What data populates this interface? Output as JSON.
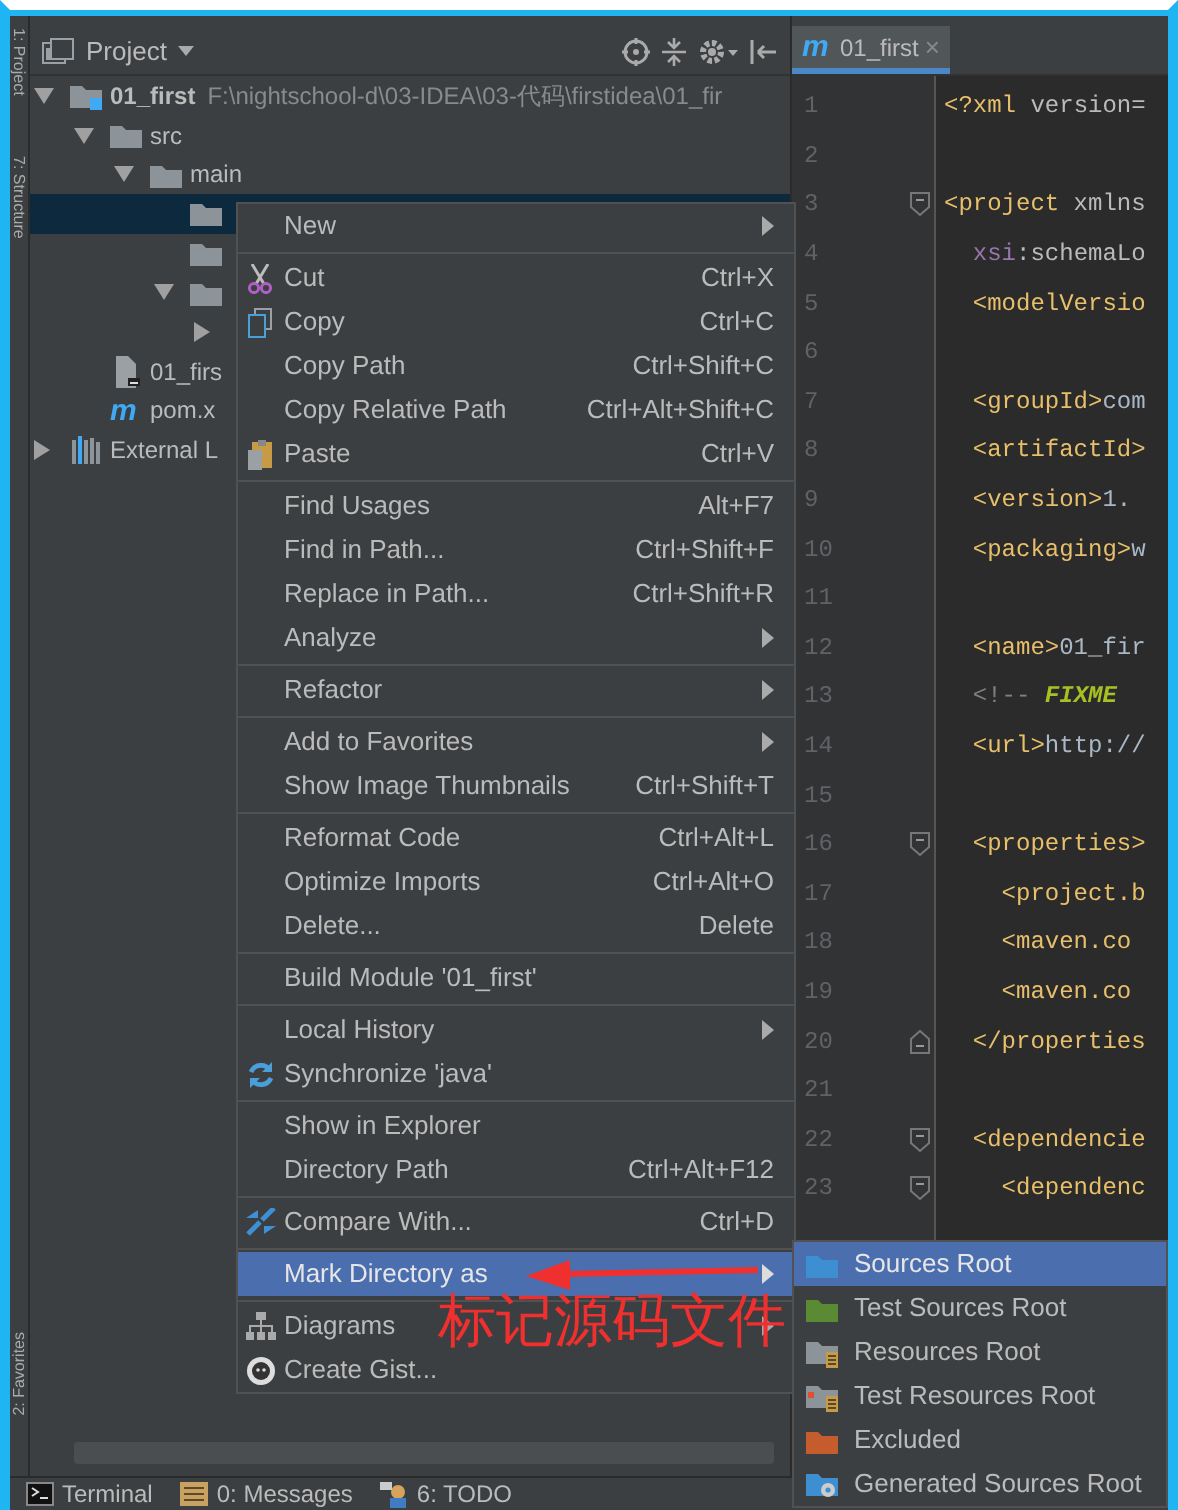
{
  "sidebar": {
    "top_tabs": [
      "1: Project",
      "7: Structure"
    ],
    "bottom_tabs": [
      "2: Favorites"
    ]
  },
  "project_panel": {
    "title": "Project",
    "tree": [
      {
        "label": "01_first",
        "path": "F:\\nightschool-d\\03-IDEA\\03-代码\\firstidea\\01_fir",
        "kind": "module",
        "expanded": true,
        "selected": false,
        "children": [
          {
            "label": "src",
            "kind": "folder",
            "expanded": true,
            "selected": false,
            "children": [
              {
                "label": "main",
                "kind": "folder",
                "expanded": true,
                "selected": false,
                "children": [
                  {
                    "kind": "folder",
                    "selected": true
                  },
                  {
                    "kind": "folder",
                    "selected": false
                  },
                  {
                    "kind": "folder",
                    "expanded": true,
                    "selected": false,
                    "children": [
                      {
                        "expanded": false,
                        "selected": false
                      }
                    ]
                  }
                ]
              }
            ]
          },
          {
            "label": "01_firs",
            "kind": "module-file",
            "selected": false
          },
          {
            "label": "pom.x",
            "kind": "maven",
            "icon_glyph": "m",
            "selected": false
          }
        ]
      },
      {
        "label": "External L",
        "kind": "library",
        "expanded": false,
        "selected": false
      }
    ]
  },
  "editor": {
    "tab": {
      "label": "01_first",
      "icon_glyph": "m",
      "close": "×",
      "selected": true
    },
    "lines": [
      {
        "number": "1",
        "fold_open": false,
        "fold_close": false,
        "segments": [
          {
            "kind": "tag",
            "text": "<?xml"
          },
          {
            "kind": "attr",
            "text": " version="
          }
        ]
      },
      {
        "number": "2",
        "fold_open": false,
        "fold_close": false
      },
      {
        "number": "3",
        "fold_open": true,
        "fold_close": false,
        "segments": [
          {
            "kind": "tag",
            "text": "<project"
          },
          {
            "kind": "attr",
            "text": " xmlns"
          }
        ]
      },
      {
        "number": "4",
        "fold_open": false,
        "fold_close": false,
        "segments": [
          {
            "kind": "ns",
            "text": "  xsi"
          },
          {
            "kind": "attr",
            "text": ":schemaLo"
          }
        ]
      },
      {
        "number": "5",
        "fold_open": false,
        "fold_close": false,
        "segments": [
          {
            "kind": "tag",
            "text": "  <modelVersio"
          }
        ]
      },
      {
        "number": "6",
        "fold_open": false,
        "fold_close": false
      },
      {
        "number": "7",
        "fold_open": false,
        "fold_close": false,
        "segments": [
          {
            "kind": "tag",
            "text": "  <groupId>"
          },
          {
            "kind": "text",
            "text": "com"
          }
        ]
      },
      {
        "number": "8",
        "fold_open": false,
        "fold_close": false,
        "segments": [
          {
            "kind": "tag",
            "text": "  <artifactId>"
          }
        ]
      },
      {
        "number": "9",
        "fold_open": false,
        "fold_close": false,
        "segments": [
          {
            "kind": "tag",
            "text": "  <version>"
          },
          {
            "kind": "text",
            "text": "1."
          }
        ]
      },
      {
        "number": "10",
        "fold_open": false,
        "fold_close": false,
        "segments": [
          {
            "kind": "tag",
            "text": "  <packaging>"
          },
          {
            "kind": "text",
            "text": "w"
          }
        ]
      },
      {
        "number": "11",
        "fold_open": false,
        "fold_close": false
      },
      {
        "number": "12",
        "fold_open": false,
        "fold_close": false,
        "segments": [
          {
            "kind": "tag",
            "text": "  <name>"
          },
          {
            "kind": "text",
            "text": "01_fir"
          }
        ]
      },
      {
        "number": "13",
        "fold_open": false,
        "fold_close": false,
        "segments": [
          {
            "kind": "comment",
            "text": "  <!-- "
          },
          {
            "kind": "todo",
            "text": "FIXME"
          }
        ]
      },
      {
        "number": "14",
        "fold_open": false,
        "fold_close": false,
        "segments": [
          {
            "kind": "tag",
            "text": "  <url>"
          },
          {
            "kind": "text",
            "text": "http://"
          }
        ]
      },
      {
        "number": "15",
        "fold_open": false,
        "fold_close": false
      },
      {
        "number": "16",
        "fold_open": true,
        "fold_close": false,
        "segments": [
          {
            "kind": "tag",
            "text": "  <properties>"
          }
        ]
      },
      {
        "number": "17",
        "fold_open": false,
        "fold_close": false,
        "segments": [
          {
            "kind": "tag",
            "text": "    <project.b"
          }
        ]
      },
      {
        "number": "18",
        "fold_open": false,
        "fold_close": false,
        "segments": [
          {
            "kind": "tag",
            "text": "    <maven.co"
          }
        ]
      },
      {
        "number": "19",
        "fold_open": false,
        "fold_close": false,
        "segments": [
          {
            "kind": "tag",
            "text": "    <maven.co"
          }
        ]
      },
      {
        "number": "20",
        "fold_open": false,
        "fold_close": true,
        "segments": [
          {
            "kind": "tag",
            "text": "  </properties"
          }
        ]
      },
      {
        "number": "21",
        "fold_open": false,
        "fold_close": false
      },
      {
        "number": "22",
        "fold_open": true,
        "fold_close": false,
        "segments": [
          {
            "kind": "tag",
            "text": "  <dependencie"
          }
        ]
      },
      {
        "number": "23",
        "fold_open": true,
        "fold_close": false,
        "segments": [
          {
            "kind": "tag",
            "text": "    <dependenc"
          }
        ]
      }
    ]
  },
  "context_menu": {
    "groups": [
      [
        {
          "label": "New",
          "submenu": true,
          "selected": false
        }
      ],
      [
        {
          "label": "Cut",
          "shortcut": "Ctrl+X",
          "kind": "cut",
          "submenu": false,
          "selected": false
        },
        {
          "label": "Copy",
          "shortcut": "Ctrl+C",
          "kind": "copy",
          "submenu": false,
          "selected": false
        },
        {
          "label": "Copy Path",
          "shortcut": "Ctrl+Shift+C",
          "submenu": false,
          "selected": false
        },
        {
          "label": "Copy Relative Path",
          "shortcut": "Ctrl+Alt+Shift+C",
          "submenu": false,
          "selected": false
        },
        {
          "label": "Paste",
          "shortcut": "Ctrl+V",
          "kind": "paste",
          "submenu": false,
          "selected": false
        }
      ],
      [
        {
          "label": "Find Usages",
          "shortcut": "Alt+F7",
          "submenu": false,
          "selected": false
        },
        {
          "label": "Find in Path...",
          "shortcut": "Ctrl+Shift+F",
          "submenu": false,
          "selected": false
        },
        {
          "label": "Replace in Path...",
          "shortcut": "Ctrl+Shift+R",
          "submenu": false,
          "selected": false
        },
        {
          "label": "Analyze",
          "submenu": true,
          "selected": false
        }
      ],
      [
        {
          "label": "Refactor",
          "submenu": true,
          "selected": false
        }
      ],
      [
        {
          "label": "Add to Favorites",
          "submenu": true,
          "selected": false
        },
        {
          "label": "Show Image Thumbnails",
          "shortcut": "Ctrl+Shift+T",
          "submenu": false,
          "selected": false
        }
      ],
      [
        {
          "label": "Reformat Code",
          "shortcut": "Ctrl+Alt+L",
          "submenu": false,
          "selected": false
        },
        {
          "label": "Optimize Imports",
          "shortcut": "Ctrl+Alt+O",
          "submenu": false,
          "selected": false
        },
        {
          "label": "Delete...",
          "shortcut": "Delete",
          "submenu": false,
          "selected": false
        }
      ],
      [
        {
          "label": "Build Module '01_first'",
          "submenu": false,
          "selected": false
        }
      ],
      [
        {
          "label": "Local History",
          "submenu": true,
          "selected": false
        },
        {
          "label": "Synchronize 'java'",
          "kind": "sync",
          "submenu": false,
          "selected": false
        }
      ],
      [
        {
          "label": "Show in Explorer",
          "submenu": false,
          "selected": false
        },
        {
          "label": "Directory Path",
          "shortcut": "Ctrl+Alt+F12",
          "submenu": false,
          "selected": false
        }
      ],
      [
        {
          "label": "Compare With...",
          "shortcut": "Ctrl+D",
          "kind": "compare",
          "submenu": false,
          "selected": false
        }
      ],
      [
        {
          "label": "Mark Directory as",
          "submenu": true,
          "selected": true
        }
      ],
      [
        {
          "label": "Diagrams",
          "kind": "diagram",
          "submenu": true,
          "selected": false
        },
        {
          "label": "Create Gist...",
          "kind": "gist",
          "submenu": false,
          "selected": false
        }
      ]
    ]
  },
  "submenu": {
    "items": [
      {
        "label": "Sources Root",
        "kind": "sources",
        "selected": true
      },
      {
        "label": "Test Sources Root",
        "kind": "test-sources",
        "selected": false
      },
      {
        "label": "Resources Root",
        "kind": "resources",
        "selected": false
      },
      {
        "label": "Test Resources Root",
        "kind": "test-resources",
        "selected": false
      },
      {
        "label": "Excluded",
        "kind": "excluded",
        "selected": false
      },
      {
        "label": "Generated Sources Root",
        "kind": "generated",
        "selected": false
      }
    ]
  },
  "annotation": {
    "text": "标记源码文件"
  },
  "status_bar": {
    "items": [
      {
        "label": "Terminal",
        "kind": "terminal"
      },
      {
        "label": "0: Messages",
        "kind": "messages"
      },
      {
        "label": "6: TODO",
        "kind": "todo"
      }
    ]
  }
}
